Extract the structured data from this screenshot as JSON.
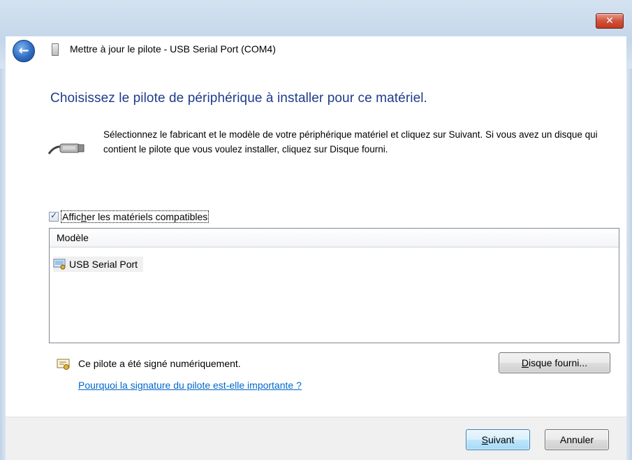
{
  "window": {
    "title": "Mettre à jour le pilote - USB Serial Port (COM4)",
    "close_glyph": "✕",
    "back_glyph": "←"
  },
  "main": {
    "heading": "Choisissez le pilote de périphérique à installer pour ce matériel.",
    "instructions": "Sélectionnez le fabricant et le modèle de votre périphérique matériel et cliquez sur Suivant. Si vous avez un disque qui contient le pilote que vous voulez installer, cliquez sur Disque fourni.",
    "show_compatible": {
      "checked": true,
      "label_before": "Affic",
      "label_accel": "h",
      "label_after": "er les matériels compatibles"
    },
    "list": {
      "column_header": "Modèle",
      "items": [
        {
          "label": "USB Serial Port"
        }
      ]
    },
    "signed_text": "Ce pilote a été signé numériquement.",
    "why_link": "Pourquoi la signature du pilote est-elle importante ?",
    "disk_button": {
      "accel": "D",
      "rest": "isque fourni..."
    }
  },
  "footer": {
    "next_button": {
      "accel": "S",
      "rest": "uivant"
    },
    "cancel_button": "Annuler"
  },
  "icons": {
    "back": "back-arrow-icon",
    "device": "usb-device-icon",
    "cable": "serial-cable-icon",
    "list_item": "driver-icon",
    "signed": "certificate-icon"
  },
  "colors": {
    "heading": "#1e3c8c",
    "link": "#0066cc",
    "close": "#c23a22"
  }
}
